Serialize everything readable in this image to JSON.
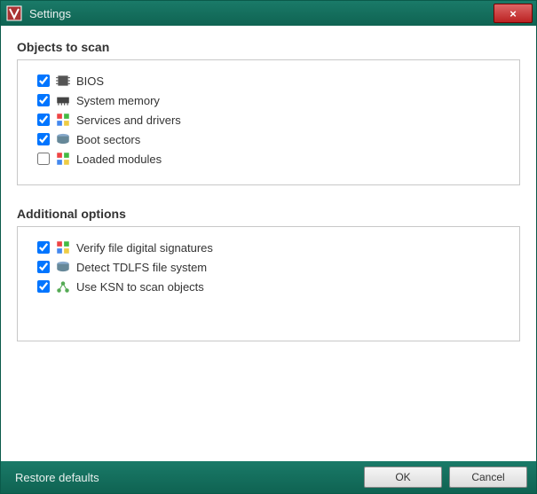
{
  "window": {
    "title": "Settings",
    "close_label": "×"
  },
  "sections": {
    "objects": {
      "title": "Objects to scan",
      "items": [
        {
          "label": "BIOS",
          "checked": true,
          "icon": "chip-icon"
        },
        {
          "label": "System memory",
          "checked": true,
          "icon": "memory-icon"
        },
        {
          "label": "Services and drivers",
          "checked": true,
          "icon": "windows-icon"
        },
        {
          "label": "Boot sectors",
          "checked": true,
          "icon": "disk-icon"
        },
        {
          "label": "Loaded modules",
          "checked": false,
          "icon": "windows-icon"
        }
      ]
    },
    "additional": {
      "title": "Additional options",
      "items": [
        {
          "label": "Verify file digital signatures",
          "checked": true,
          "icon": "windows-icon"
        },
        {
          "label": "Detect TDLFS file system",
          "checked": true,
          "icon": "disk-icon"
        },
        {
          "label": "Use KSN to scan objects",
          "checked": true,
          "icon": "network-icon"
        }
      ]
    }
  },
  "footer": {
    "restore": "Restore defaults",
    "ok": "OK",
    "cancel": "Cancel"
  }
}
